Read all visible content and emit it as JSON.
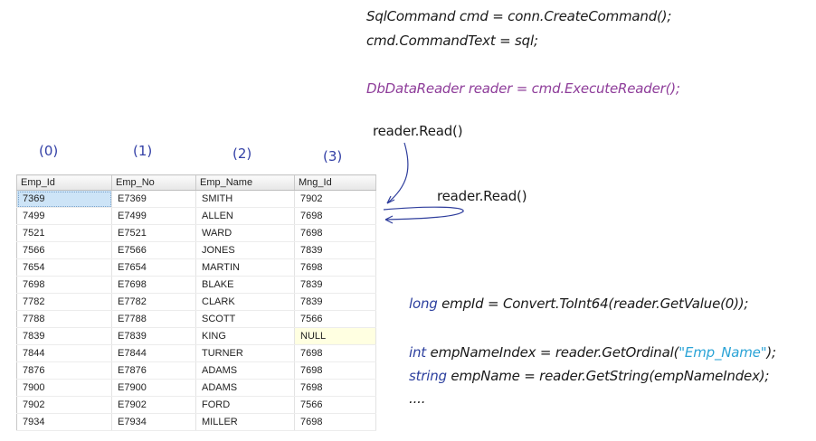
{
  "code_top": {
    "line1": "SqlCommand cmd = conn.CreateCommand();",
    "line2": "cmd.CommandText = sql;",
    "line3": "DbDataReader reader = cmd.ExecuteReader();"
  },
  "annotations": {
    "read1": "reader.Read()",
    "read2": "reader.Read()"
  },
  "indices": [
    "(0)",
    "(1)",
    "(2)",
    "(3)"
  ],
  "table": {
    "columns": [
      "Emp_Id",
      "Emp_No",
      "Emp_Name",
      "Mng_Id"
    ],
    "rows": [
      [
        "7369",
        "E7369",
        "SMITH",
        "7902"
      ],
      [
        "7499",
        "E7499",
        "ALLEN",
        "7698"
      ],
      [
        "7521",
        "E7521",
        "WARD",
        "7698"
      ],
      [
        "7566",
        "E7566",
        "JONES",
        "7839"
      ],
      [
        "7654",
        "E7654",
        "MARTIN",
        "7698"
      ],
      [
        "7698",
        "E7698",
        "BLAKE",
        "7839"
      ],
      [
        "7782",
        "E7782",
        "CLARK",
        "7839"
      ],
      [
        "7788",
        "E7788",
        "SCOTT",
        "7566"
      ],
      [
        "7839",
        "E7839",
        "KING",
        "NULL"
      ],
      [
        "7844",
        "E7844",
        "TURNER",
        "7698"
      ],
      [
        "7876",
        "E7876",
        "ADAMS",
        "7698"
      ],
      [
        "7900",
        "E7900",
        "ADAMS",
        "7698"
      ],
      [
        "7902",
        "E7902",
        "FORD",
        "7566"
      ],
      [
        "7934",
        "E7934",
        "MILLER",
        "7698"
      ]
    ]
  },
  "code_bottom": {
    "l1_kw": "long",
    "l1_rest": " empId =  Convert.ToInt64(reader.GetValue(0));",
    "l2_kw": "int",
    "l2_mid": " empNameIndex = reader.GetOrdinal(",
    "l2_str": "\"Emp_Name\"",
    "l2_end": ");",
    "l3_kw": "string",
    "l3_rest": " empName = reader.GetString(empNameIndex);",
    "l4": "...."
  },
  "colors": {
    "purple": "#8e3d9a",
    "keyword_blue": "#2c3f9e",
    "string_cyan": "#2aa3d6",
    "arrow_blue": "#2e3d9c"
  }
}
